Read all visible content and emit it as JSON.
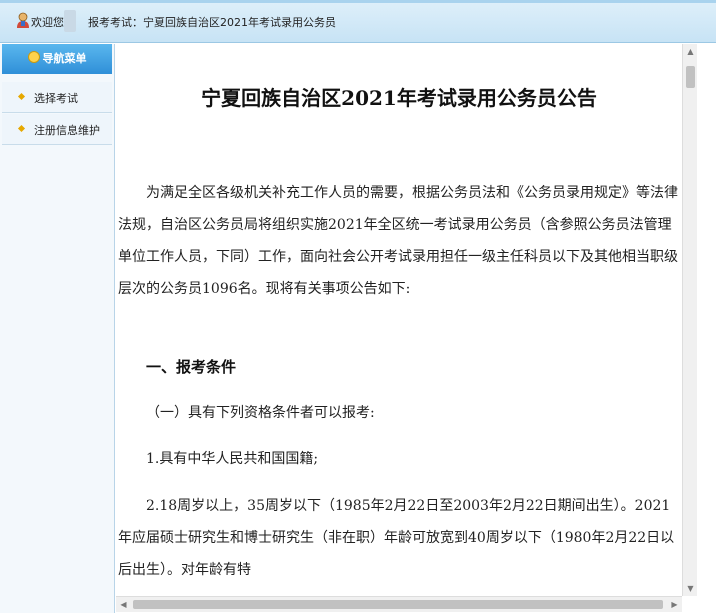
{
  "header": {
    "welcome": "欢迎您：",
    "exam_label": "报考考试：宁夏回族自治区2021年考试录用公务员"
  },
  "sidebar": {
    "title": "导航菜单",
    "items": [
      {
        "label": "选择考试"
      },
      {
        "label": "注册信息维护"
      }
    ]
  },
  "document": {
    "title": "宁夏回族自治区2021年考试录用公务员公告",
    "intro": "为满足全区各级机关补充工作人员的需要，根据公务员法和《公务员录用规定》等法律法规，自治区公务员局将组织实施2021年全区统一考试录用公务员（含参照公务员法管理单位工作人员，下同）工作，面向社会公开考试录用担任一级主任科员以下及其他相当职级层次的公务员1096名。现将有关事项公告如下:",
    "section1": "一、报考条件",
    "sub1": "（一）具有下列资格条件者可以报考:",
    "item1": "1.具有中华人民共和国国籍;",
    "item2": "2.18周岁以上，35周岁以下（1985年2月22日至2003年2月22日期间出生）。2021年应届硕士研究生和博士研究生（非在职）年龄可放宽到40周岁以下（1980年2月22日以后出生）。对年龄有特"
  },
  "colors": {
    "header_bg": "#c7e3f5",
    "nav_title_bg": "#2f8fd8",
    "bullet": "#e6a800"
  }
}
